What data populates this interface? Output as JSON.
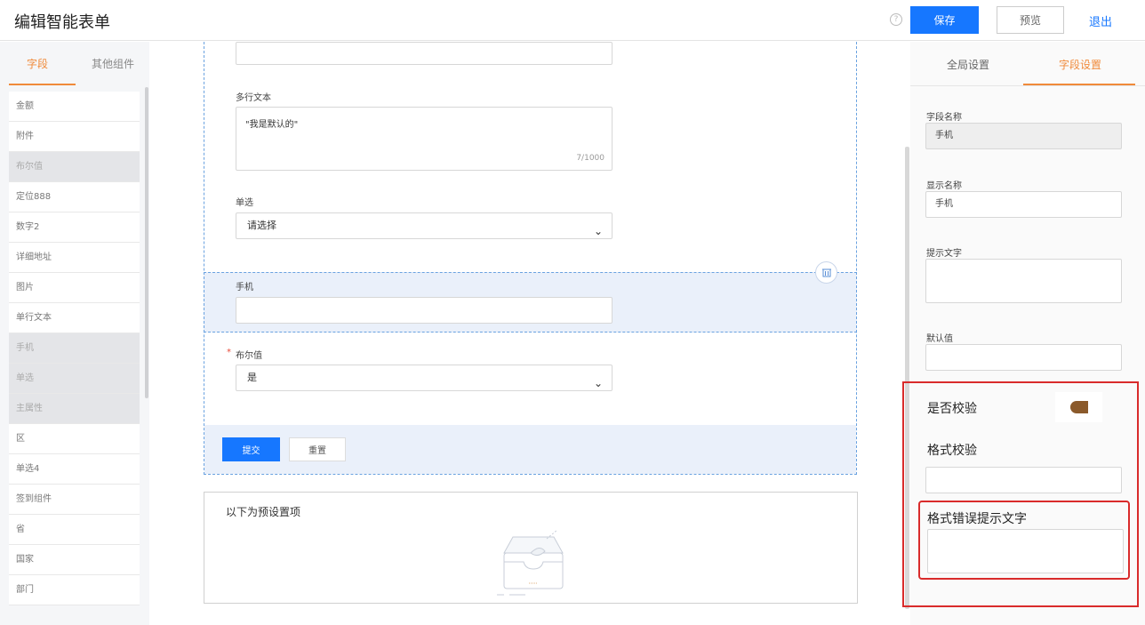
{
  "header": {
    "title": "编辑智能表单",
    "help": "?",
    "save_label": "保存",
    "preview_label": "预览",
    "exit_label": "退出"
  },
  "left_panel": {
    "tabs": [
      "字段",
      "其他组件"
    ],
    "active_tab": "字段",
    "fields": [
      {
        "label": "金额",
        "disabled": false
      },
      {
        "label": "附件",
        "disabled": false
      },
      {
        "label": "布尔值",
        "disabled": true
      },
      {
        "label": "定位888",
        "disabled": false
      },
      {
        "label": "数字2",
        "disabled": false
      },
      {
        "label": "详细地址",
        "disabled": false
      },
      {
        "label": "图片",
        "disabled": false
      },
      {
        "label": "单行文本",
        "disabled": false
      },
      {
        "label": "手机",
        "disabled": true
      },
      {
        "label": "单选",
        "disabled": true
      },
      {
        "label": "主属性",
        "disabled": true
      },
      {
        "label": "区",
        "disabled": false
      },
      {
        "label": "单选4",
        "disabled": false
      },
      {
        "label": "签到组件",
        "disabled": false
      },
      {
        "label": "省",
        "disabled": false
      },
      {
        "label": "国家",
        "disabled": false
      },
      {
        "label": "部门",
        "disabled": false
      }
    ]
  },
  "form": {
    "multiline_label": "多行文本",
    "multiline_value": "\"我是默认的\"",
    "multiline_counter": "7/1000",
    "single_select_label": "单选",
    "single_select_placeholder": "请选择",
    "mobile_label": "手机",
    "bool_required_mark": "*",
    "bool_label": "布尔值",
    "bool_value": "是",
    "submit_label": "提交",
    "reset_label": "重置",
    "preset_title": "以下为预设置项"
  },
  "right_panel": {
    "tabs": [
      "全局设置",
      "字段设置"
    ],
    "active_tab": "字段设置",
    "field_name_label": "字段名称",
    "field_name_value": "手机",
    "display_name_label": "显示名称",
    "display_name_value": "手机",
    "hint_label": "提示文字",
    "default_label": "默认值",
    "validate_label": "是否校验",
    "validate_enabled": true,
    "format_label": "格式校验",
    "format_error_label": "格式错误提示文字"
  },
  "colors": {
    "primary": "#1677ff",
    "accent": "#f08a3a",
    "highlight": "#d92b2b",
    "toggle": "#8b5a2b"
  }
}
